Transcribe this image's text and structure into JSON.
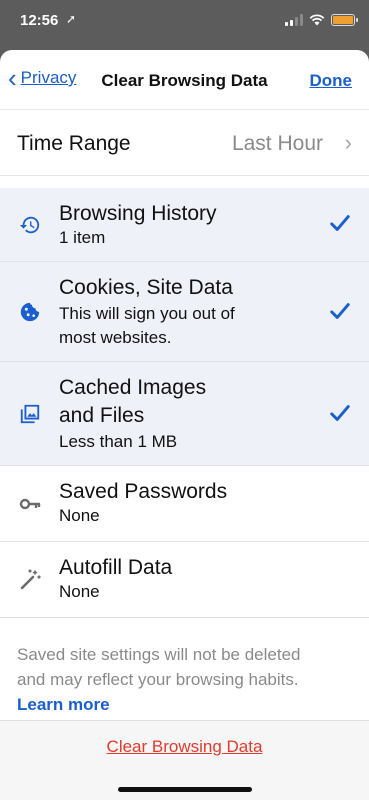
{
  "status_bar": {
    "time": "12:56",
    "location_glyph": "➚",
    "signal_bars": 4,
    "signal_filled": 2,
    "wifi": true,
    "battery_color": "#f0a030"
  },
  "nav": {
    "back_label": "Privacy",
    "title": "Clear Browsing Data",
    "done_label": "Done"
  },
  "time_range": {
    "label": "Time Range",
    "value": "Last Hour"
  },
  "items": [
    {
      "title_lines": [
        "Browsing History"
      ],
      "subtitle_lines": [
        "1 item"
      ],
      "checked": true,
      "icon": "history-icon"
    },
    {
      "title_lines": [
        "Cookies, Site Data"
      ],
      "subtitle_lines": [
        "This will sign you out of",
        "most websites."
      ],
      "checked": true,
      "icon": "cookie-icon"
    },
    {
      "title_lines": [
        "Cached Images",
        "and Files"
      ],
      "subtitle_lines": [
        "Less than 1 MB"
      ],
      "checked": true,
      "icon": "image-icon"
    },
    {
      "title_lines": [
        "Saved Passwords"
      ],
      "subtitle_lines": [
        "None"
      ],
      "checked": false,
      "icon": "key-icon"
    },
    {
      "title_lines": [
        "Autofill Data"
      ],
      "subtitle_lines": [
        "None"
      ],
      "checked": false,
      "icon": "magic-wand-icon"
    }
  ],
  "footer": {
    "note_line1": "Saved site settings will not be deleted",
    "note_line2": "and may reflect your browsing habits.",
    "link": "Learn more"
  },
  "bottom_button": "Clear Browsing Data",
  "colors": {
    "accent": "#1a5fd0",
    "destructive": "#e23b2e",
    "selected_row_bg": "#eef1f8"
  }
}
